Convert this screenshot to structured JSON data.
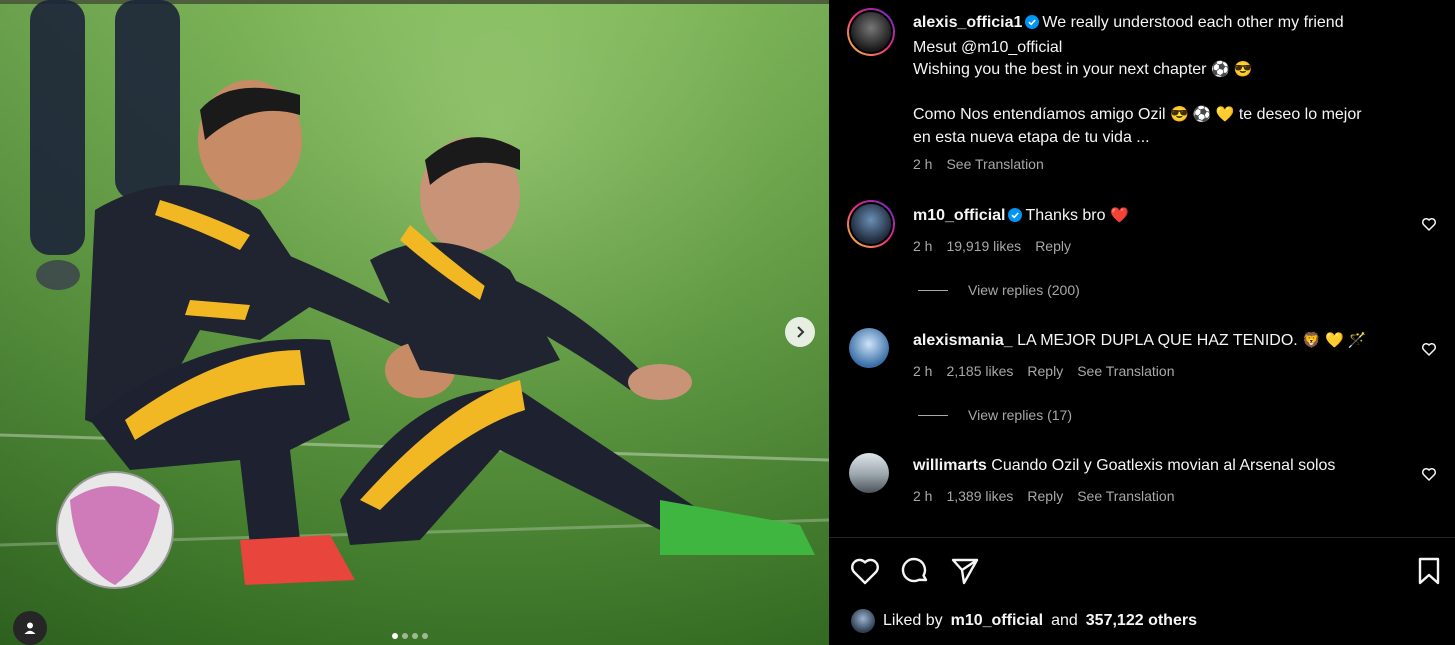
{
  "post": {
    "author": "alexis_officia1",
    "caption_line1": "We really understood each other my friend",
    "caption_line2": "Mesut @m10_official",
    "caption_line3": "Wishing you the best in your next chapter",
    "caption_line3_emojis": "⚽ 😎",
    "caption_es_part1": "Como Nos entendíamos amigo Ozil",
    "caption_es_emojis": "😎 ⚽ 💛",
    "caption_es_part2": "te deseo lo mejor",
    "caption_es_line2": "en esta nueva etapa de tu vida ...",
    "time": "2 h",
    "see_translation": "See Translation"
  },
  "comments": [
    {
      "user": "m10_official",
      "verified": true,
      "text": "Thanks bro",
      "emoji": "❤️",
      "time": "2 h",
      "likes": "19,919 likes",
      "reply": "Reply",
      "view_replies": "View replies (200)"
    },
    {
      "user": "alexismania_",
      "verified": false,
      "text": "LA MEJOR DUPLA QUE HAZ TENIDO.",
      "emoji": "🦁 💛 🪄",
      "time": "2 h",
      "likes": "2,185 likes",
      "reply": "Reply",
      "see_translation": "See Translation",
      "view_replies": "View replies (17)"
    },
    {
      "user": "willimarts",
      "verified": false,
      "text": "Cuando Ozil y Goatlexis movian al Arsenal solos",
      "time": "2 h",
      "likes": "1,389 likes",
      "reply": "Reply",
      "see_translation": "See Translation"
    }
  ],
  "likes_summary": {
    "prefix": "Liked by",
    "user": "m10_official",
    "and": "and",
    "others": "357,122 others"
  },
  "colors": {
    "verified": "#0095f6",
    "muted": "#a8a8a8",
    "heart_red": "#ff3040"
  }
}
